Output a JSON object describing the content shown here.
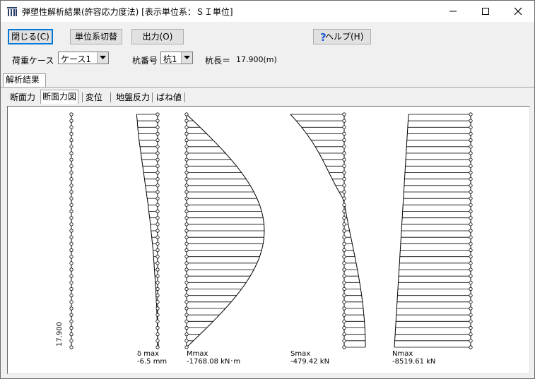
{
  "window": {
    "title": "弾塑性解析結果(許容応力度法) [表示単位系：ＳＩ単位]",
    "icons": [
      "app-icon",
      "minimize-icon",
      "maximize-icon",
      "close-icon"
    ]
  },
  "toolbar": {
    "close_label": "閉じる(C)",
    "unit_switch_label": "単位系切替",
    "output_label": "出力(O)",
    "help_label": "ヘルプ(H)"
  },
  "controls": {
    "load_case_label": "荷重ケース",
    "load_case_value": "ケース1",
    "pile_no_label": "杭番号",
    "pile_no_value": "杭1",
    "pile_length_label": "杭長＝",
    "pile_length_value": "17.900(m)"
  },
  "tabs": {
    "main": "解析結果",
    "sub": [
      "断面力",
      "断面力図",
      "変位",
      "地盤反力",
      "ばね値"
    ],
    "active_sub": "断面力図"
  },
  "diagram": {
    "pile_length_label": "17.900",
    "nodes": 37,
    "line_color": "#000000",
    "panels": [
      {
        "key": "disp",
        "name": "δmax",
        "value": "-6.5 mm",
        "shape": [
          -0.93,
          -0.9,
          -0.88,
          -0.85,
          -0.82,
          -0.78,
          -0.74,
          -0.7,
          -0.66,
          -0.62,
          -0.58,
          -0.54,
          -0.5,
          -0.46,
          -0.42,
          -0.39,
          -0.35,
          -0.32,
          -0.29,
          -0.26,
          -0.23,
          -0.2,
          -0.18,
          -0.16,
          -0.14,
          -0.12,
          -0.1,
          -0.08,
          -0.07,
          -0.05,
          -0.04,
          -0.03,
          -0.02,
          -0.01,
          0.0,
          0.02,
          0.04
        ]
      },
      {
        "key": "moment",
        "name": "Mmax",
        "value": "-1768.08 kN･m"
      },
      {
        "key": "shear",
        "name": "Smax",
        "value": "-479.42 kN"
      },
      {
        "key": "axial",
        "name": "Nmax",
        "value": "-8519.61 kN"
      }
    ]
  }
}
